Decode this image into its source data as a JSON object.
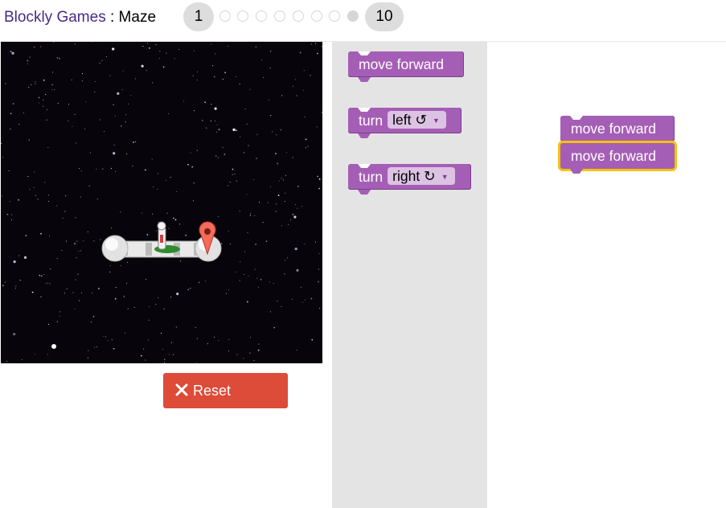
{
  "header": {
    "brand": "Blockly Games",
    "separator": " : ",
    "game": "Maze",
    "level_first": "1",
    "level_last": "10",
    "current_level_index": 8
  },
  "reset_button": {
    "label": "Reset"
  },
  "toolbox": {
    "blocks": [
      {
        "text": "move forward"
      },
      {
        "text": "turn",
        "dropdown": "left ↺"
      },
      {
        "text": "turn",
        "dropdown": "right ↻"
      }
    ]
  },
  "workspace": {
    "blocks": [
      {
        "text": "move forward"
      },
      {
        "text": "move forward",
        "selected": true
      }
    ]
  },
  "colors": {
    "block": "#a55eb5",
    "brand": "#4a2a86",
    "reset": "#dd4b39",
    "selection": "#f4c20d",
    "toolbox": "#e4e4e4"
  },
  "icons": [
    "close-icon",
    "astronaut-icon",
    "marker-icon",
    "dropdown-arrow-icon"
  ]
}
